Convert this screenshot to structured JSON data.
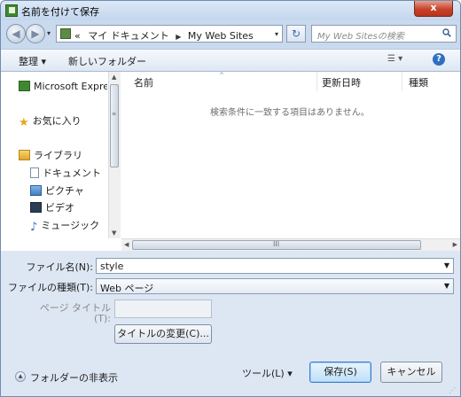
{
  "window": {
    "title": "名前を付けて保存",
    "close_glyph": "x"
  },
  "address": {
    "back_glyph": "◀",
    "forward_glyph": "▶",
    "overflow": "«",
    "crumbs": [
      "マイ ドキュメント",
      "My Web Sites"
    ],
    "crumb_sep": "▶",
    "search_placeholder": "My Web Sitesの検索"
  },
  "toolbar": {
    "organize": "整理 ▾",
    "new_folder": "新しいフォルダー",
    "views": "☰ ▾",
    "help": "?"
  },
  "nav": {
    "items": [
      {
        "label": "Microsoft Express",
        "icon": "app-icon"
      },
      {
        "label": "お気に入り",
        "icon": "star-icon"
      },
      {
        "label": "ライブラリ",
        "icon": "library-icon"
      },
      {
        "label": "ドキュメント",
        "icon": "document-icon"
      },
      {
        "label": "ピクチャ",
        "icon": "picture-icon"
      },
      {
        "label": "ビデオ",
        "icon": "video-icon"
      },
      {
        "label": "ミュージック",
        "icon": "music-icon"
      }
    ]
  },
  "list": {
    "columns": [
      "名前",
      "更新日時",
      "種類"
    ],
    "empty_message": "検索条件に一致する項目はありません。",
    "scroll_grip": "III"
  },
  "form": {
    "filename_label": "ファイル名(N):",
    "filename_value": "style",
    "filetype_label": "ファイルの種類(T):",
    "filetype_value": "Web ページ",
    "pagetitle_label_1": "ページ タイトル",
    "pagetitle_label_2": "(T):",
    "change_title_button": "タイトルの変更(C)...",
    "hide_folders": "フォルダーの非表示",
    "tools_menu": "ツール(L)  ▾",
    "save_button": "保存(S)",
    "cancel_button": "キャンセル"
  },
  "colors": {
    "accent": "#3a7bd5",
    "chrome": "#dde7f3",
    "close": "#c7432a"
  }
}
